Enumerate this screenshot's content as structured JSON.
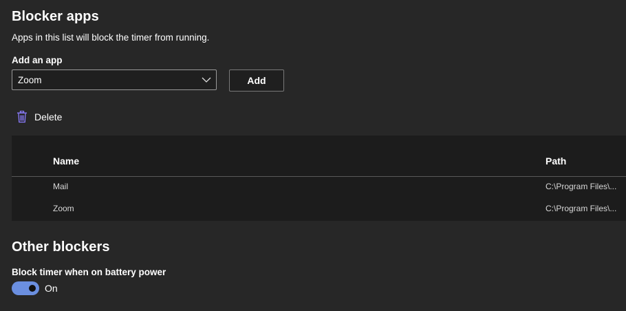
{
  "blocker_apps": {
    "title": "Blocker apps",
    "description": "Apps in this list will block the timer from running.",
    "add_label": "Add an app",
    "select_value": "Zoom",
    "add_button": "Add",
    "delete_button": "Delete"
  },
  "table": {
    "columns": [
      "Name",
      "Path"
    ],
    "rows": [
      {
        "name": "Mail",
        "path": "C:\\Program Files\\..."
      },
      {
        "name": "Zoom",
        "path": "C:\\Program Files\\..."
      }
    ]
  },
  "other_blockers": {
    "title": "Other blockers",
    "battery_label": "Block timer when on battery power",
    "battery_toggle_on": true,
    "battery_state": "On"
  },
  "icons": {
    "delete": "trash-icon",
    "dropdown": "chevron-down-icon"
  },
  "colors": {
    "background": "#272727",
    "table_background": "#1c1c1c",
    "accent": "#6b8fe0",
    "delete_icon": "#8b7cff"
  }
}
